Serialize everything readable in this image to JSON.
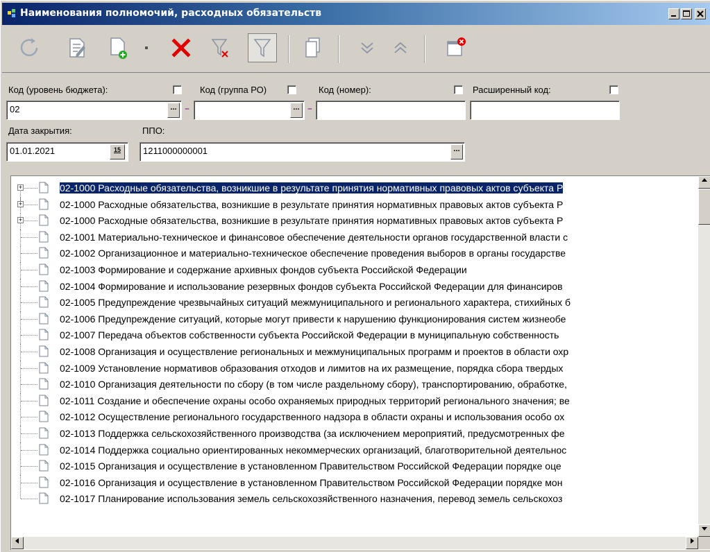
{
  "window": {
    "title": "Наименования полномочий, расходных обязательств"
  },
  "filters": {
    "level_label": "Код (уровень бюджета):",
    "level_value": "02",
    "group_label": "Код (группа РО)",
    "group_value": "",
    "number_label": "Код (номер):",
    "number_value": "",
    "ext_label": "Расширенный код:",
    "ext_value": "",
    "date_label": "Дата закрытия:",
    "date_value": "01.01.2021",
    "calendar_glyph": "15",
    "ppo_label": "ППО:",
    "ppo_value": "1211000000001"
  },
  "tree": {
    "rows": [
      {
        "code": "02-1000",
        "text": "Расходные обязательства, возникшие в результате принятия нормативных правовых актов субъекта Р",
        "expandable": true
      },
      {
        "code": "02-1000",
        "text": "Расходные обязательства, возникшие в результате принятия нормативных правовых актов субъекта Р",
        "expandable": true
      },
      {
        "code": "02-1000",
        "text": "Расходные обязательства, возникшие в результате принятия нормативных правовых актов субъекта Р",
        "expandable": true
      },
      {
        "code": "02-1001",
        "text": "Материально-техническое и финансовое обеспечение деятельности органов государственной власти с",
        "expandable": false
      },
      {
        "code": "02-1002",
        "text": "Организационное и материально-техническое обеспечение проведения выборов в органы государстве",
        "expandable": false
      },
      {
        "code": "02-1003",
        "text": "Формирование и содержание архивных фондов субъекта Российской Федерации",
        "expandable": false
      },
      {
        "code": "02-1004",
        "text": "Формирование и использование резервных фондов субъекта Российской Федерации для финансиров",
        "expandable": false
      },
      {
        "code": "02-1005",
        "text": "Предупреждение чрезвычайных ситуаций межмуниципального и регионального характера, стихийных б",
        "expandable": false
      },
      {
        "code": "02-1006",
        "text": "Предупреждение ситуаций, которые могут привести к нарушению функционирования систем жизнеобе",
        "expandable": false
      },
      {
        "code": "02-1007",
        "text": "Передача объектов собственности субъекта Российской Федерации в муниципальную собственность",
        "expandable": false
      },
      {
        "code": "02-1008",
        "text": "Организация и осуществление региональных и межмуниципальных программ и проектов в области охр",
        "expandable": false
      },
      {
        "code": "02-1009",
        "text": "Установление нормативов образования отходов и лимитов на их размещение, порядка сбора твердых",
        "expandable": false
      },
      {
        "code": "02-1010",
        "text": "Организация деятельности по сбору (в том числе раздельному сбору), транспортированию, обработке,",
        "expandable": false
      },
      {
        "code": "02-1011",
        "text": "Создание и обеспечение охраны особо охраняемых природных территорий регионального значения; ве",
        "expandable": false
      },
      {
        "code": "02-1012",
        "text": "Осуществление регионального государственного надзора в области охраны и использования особо ох",
        "expandable": false
      },
      {
        "code": "02-1013",
        "text": "Поддержка сельскохозяйственного производства (за исключением мероприятий, предусмотренных фе",
        "expandable": false
      },
      {
        "code": "02-1014",
        "text": "Поддержка социально ориентированных некоммерческих организаций, благотворительной деятельнос",
        "expandable": false
      },
      {
        "code": "02-1015",
        "text": "Организация и осуществление в установленном Правительством Российской Федерации порядке оце",
        "expandable": false
      },
      {
        "code": "02-1016",
        "text": "Организация и осуществление в установленном Правительством Российской Федерации порядке мон",
        "expandable": false
      },
      {
        "code": "02-1017",
        "text": "Планирование использования земель сельскохозяйственного назначения, перевод земель сельскохоз",
        "expandable": false
      }
    ]
  },
  "colors": {
    "selection": "#0a246a",
    "dash": "#800080",
    "delete": "#e00000",
    "add": "#22aa22"
  }
}
